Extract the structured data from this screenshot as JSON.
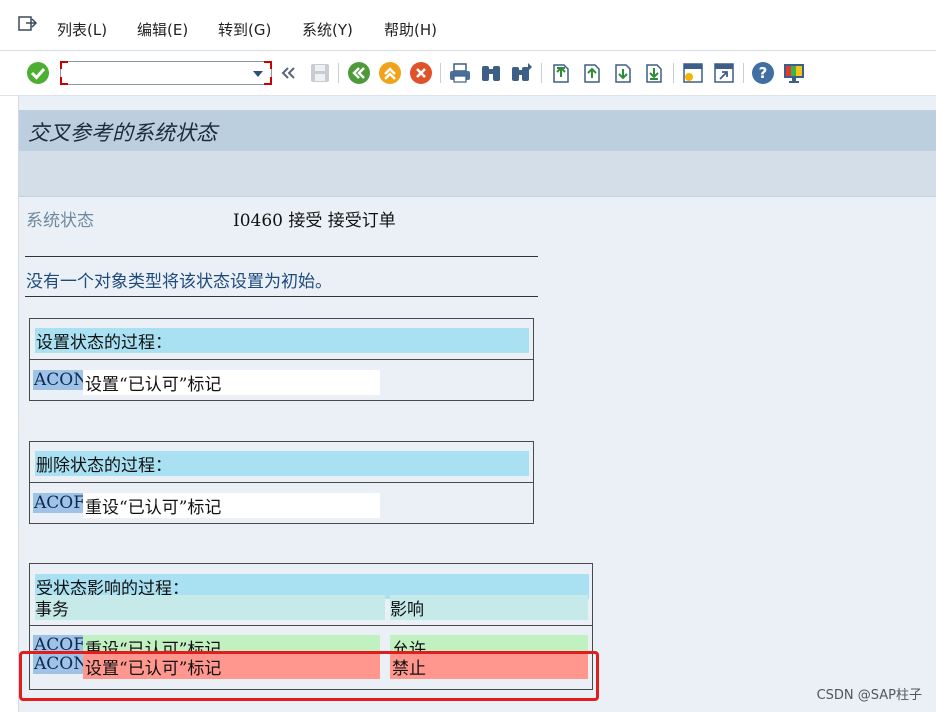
{
  "menu": {
    "items": [
      "列表(L)",
      "编辑(E)",
      "转到(G)",
      "系统(Y)",
      "帮助(H)"
    ]
  },
  "toolbar": {
    "command_field_value": "",
    "icons": [
      "enter-icon",
      "back-double-icon",
      "save-icon",
      "back-icon",
      "exit-icon",
      "cancel-icon",
      "print-icon",
      "find-icon",
      "find-next-icon",
      "first-page-icon",
      "previous-page-icon",
      "next-page-icon",
      "last-page-icon",
      "create-session-icon",
      "shortcut-icon",
      "help-icon",
      "customize-layout-icon"
    ]
  },
  "screen": {
    "title": "交叉参考的系统状态",
    "status_label": "系统状态",
    "status_value": "I0460 接受 接受订单",
    "note": "没有一个对象类型将该状态设置为初始。"
  },
  "set_process": {
    "heading": "设置状态的过程：",
    "rows": [
      {
        "code": "ACON",
        "text": "设置“已认可”标记"
      }
    ]
  },
  "delete_process": {
    "heading": "删除状态的过程：",
    "rows": [
      {
        "code": "ACOF",
        "text": "重设“已认可”标记"
      }
    ]
  },
  "affected_process": {
    "heading": "受状态影响的过程：",
    "col_transaction": "事务",
    "col_effect": "影响",
    "rows": [
      {
        "code": "ACOF",
        "text": "重设“已认可”标记",
        "effect": "允许",
        "status": "allowed"
      },
      {
        "code": "ACON",
        "text": "设置“已认可”标记",
        "effect": "禁止",
        "status": "forbidden"
      }
    ]
  },
  "colors": {
    "allowed": "#c1f0c1",
    "forbidden": "#ff978e",
    "highlight_frame": "#e11d1d",
    "title_bar": "#bccfdf"
  },
  "watermark": "CSDN @SAP柱子"
}
